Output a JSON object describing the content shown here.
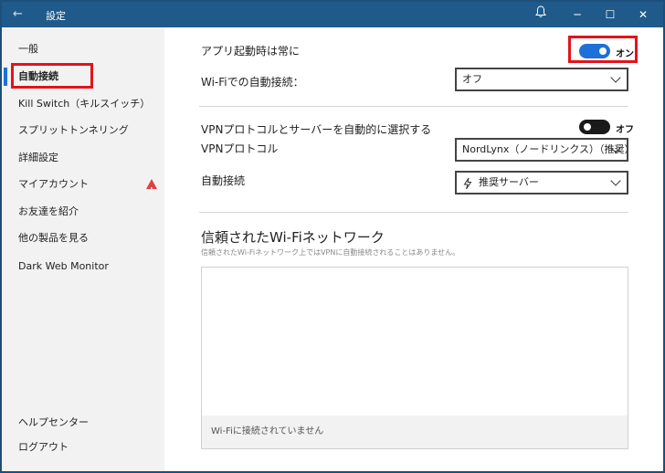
{
  "titlebar": {
    "title": "設定",
    "back_glyph": "←",
    "bell_glyph": "🔔",
    "minimize_glyph": "─",
    "maximize_glyph": "☐",
    "close_glyph": "✕"
  },
  "sidebar": {
    "items": [
      {
        "label": "一般"
      },
      {
        "label": "自動接続"
      },
      {
        "label": "Kill Switch（キルスイッチ）"
      },
      {
        "label": "スプリットトンネリング"
      },
      {
        "label": "詳細設定"
      },
      {
        "label": "マイアカウント"
      },
      {
        "label": "お友達を紹介"
      },
      {
        "label": "他の製品を見る"
      },
      {
        "label": "Dark Web Monitor"
      }
    ],
    "footer": [
      {
        "label": "ヘルプセンター"
      },
      {
        "label": "ログアウト"
      }
    ]
  },
  "main": {
    "launch_always_label": "アプリ起動時は常に",
    "launch_always_state": "オン",
    "wifi_auto_label": "Wi-Fiでの自動接続：",
    "wifi_auto_value": "オフ",
    "auto_select_label": "VPNプロトコルとサーバーを自動的に選択する",
    "auto_select_state": "オフ",
    "protocol_label": "VPNプロトコル",
    "protocol_value": "NordLynx（ノードリンクス）（推奨）",
    "auto_connect_label": "自動接続",
    "auto_connect_value": "推奨サーバー",
    "trusted_title": "信頼されたWi-Fiネットワーク",
    "trusted_subtitle": "信頼されたWi-Fiネットワーク上ではVPNに自動接続されることはありません。",
    "trusted_empty": "Wi-Fiに接続されていません"
  },
  "colors": {
    "titlebar": "#1f5a8a",
    "accent": "#1e6fd8",
    "highlight": "#e3131b",
    "warning": "#e04040"
  }
}
